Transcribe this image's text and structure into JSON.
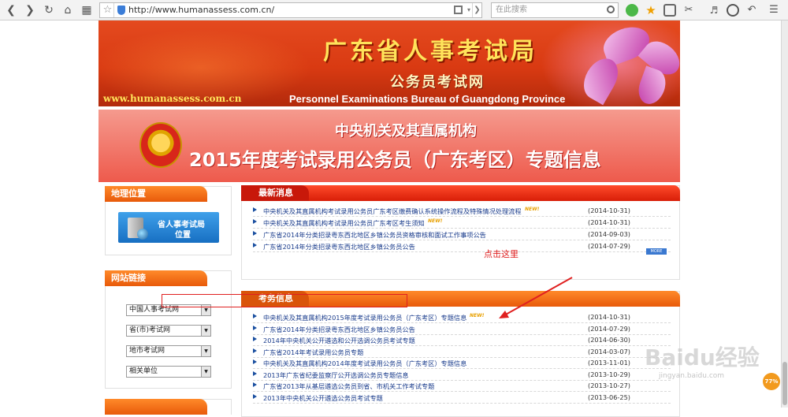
{
  "browser": {
    "url": "http://www.humanassess.com.cn/",
    "search_placeholder": "在此搜索"
  },
  "banner": {
    "title": "广东省人事考试局",
    "subtitle": "公务员考试网",
    "site_url": "www.humanassess.com.cn",
    "english": "Personnel Examinations Bureau of Guangdong Province"
  },
  "topic": {
    "line1": "中央机关及其直属机构",
    "line2": "2015年度考试录用公务员（广东考区）专题信息"
  },
  "sidebar": {
    "location_title": "地理位置",
    "location_button": [
      "省人事考试局",
      "位置"
    ],
    "links_title": "网站链接",
    "selects": [
      "中国人事考试网",
      "省(市)考试网",
      "地市考试网",
      "相关单位"
    ]
  },
  "news": {
    "title": "最新消息",
    "items": [
      {
        "title": "中央机关及其直属机构考试录用公务员广东考区缴费确认系统操作流程及特殊情况处理流程",
        "date": "(2014-10-31)",
        "new": true
      },
      {
        "title": "中央机关及其直属机构考试录用公务员广东考区考生须知",
        "date": "(2014-10-31)",
        "new": true
      },
      {
        "title": "广东省2014年分类招录粤东西北地区乡镇公务员资格审核和面试工作事项公告",
        "date": "(2014-09-03)",
        "new": false
      },
      {
        "title": "广东省2014年分类招录粤东西北地区乡镇公务员公告",
        "date": "(2014-07-29)",
        "new": false
      }
    ],
    "more_label": "MORE"
  },
  "exams": {
    "title": "考务信息",
    "items": [
      {
        "title": "中央机关及其直属机构2015年度考试录用公务员（广东考区）专题信息",
        "date": "(2014-10-31)",
        "new": true
      },
      {
        "title": "广东省2014年分类招录粤东西北地区乡镇公务员公告",
        "date": "(2014-07-29)",
        "new": false
      },
      {
        "title": "2014年中央机关公开遴选和公开选调公务员考试专题",
        "date": "(2014-06-30)",
        "new": false
      },
      {
        "title": "广东省2014年考试录用公务员专题",
        "date": "(2014-03-07)",
        "new": false
      },
      {
        "title": "中央机关及其直属机构2014年度考试录用公务员（广东考区）专题信息",
        "date": "(2013-11-01)",
        "new": false
      },
      {
        "title": "2013年广东省纪委监察厅公开选调公务员专题信息",
        "date": "(2013-10-29)",
        "new": false
      },
      {
        "title": "广东省2013年从基层遴选公务员到省、市机关工作考试专题",
        "date": "(2013-10-27)",
        "new": false
      },
      {
        "title": "2013年中央机关公开遴选公务员考试专题",
        "date": "(2013-06-25)",
        "new": false
      }
    ]
  },
  "annotation": "点击这里",
  "new_badge": "NEW!",
  "watermark": "Baidu经验",
  "watermark_url": "jingyan.baidu.com",
  "badge_percent": "77%",
  "colors": {
    "accent_red": "#d81e08",
    "accent_orange": "#e85a0a",
    "link_blue": "#1a3c8c"
  }
}
